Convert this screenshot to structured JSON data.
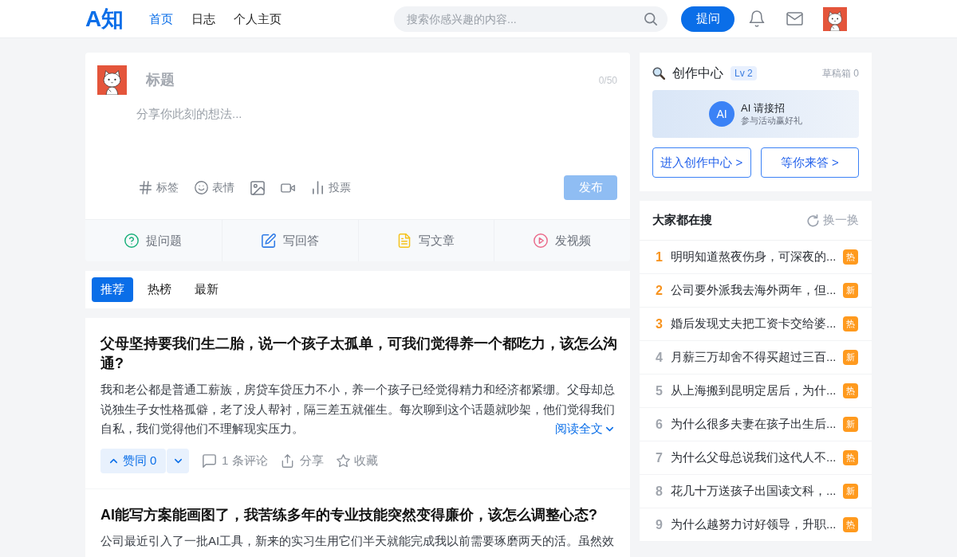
{
  "header": {
    "logo": "A知",
    "nav": [
      {
        "label": "首页",
        "selected": true
      },
      {
        "label": "日志",
        "selected": false
      },
      {
        "label": "个人主页",
        "selected": false
      }
    ],
    "search": {
      "placeholder": "搜索你感兴趣的内容..."
    },
    "ask_button": "提问"
  },
  "composer": {
    "title": {
      "placeholder": "标题"
    },
    "counter": "0/50",
    "body": {
      "placeholder": "分享你此刻的想法..."
    },
    "tools": [
      {
        "kind": "tag",
        "label": "标签"
      },
      {
        "kind": "emoji",
        "label": "表情"
      },
      {
        "kind": "image"
      },
      {
        "kind": "video"
      },
      {
        "kind": "poll",
        "label": "投票"
      }
    ],
    "publish": {
      "label": "发布",
      "disabled": true
    },
    "actions": [
      {
        "kind": "question",
        "label": "提问题"
      },
      {
        "kind": "answer",
        "label": "写回答"
      },
      {
        "kind": "article",
        "label": "写文章"
      },
      {
        "kind": "video",
        "label": "发视频"
      }
    ]
  },
  "feed_tabs": [
    {
      "label": "推荐",
      "selected": true
    },
    {
      "label": "热榜",
      "selected": false
    },
    {
      "label": "最新",
      "selected": false
    }
  ],
  "posts": [
    {
      "title": "父母坚持要我们生二胎，说一个孩子太孤单，可我们觉得养一个都吃力，该怎么沟通?",
      "body": "我和老公都是普通工薪族，房贷车贷压力不小，养一个孩子已经觉得精力和经济都紧绷。父母却总说独生子女性格孤僻，老了没人帮衬，隔三差五就催生。每次聊到这个话题就吵架，他们觉得我们自私，我们觉得他们不理解现实压力。",
      "read_more": "阅读全文",
      "vote": "赞同 0",
      "comments": "1 条评论",
      "share": "分享",
      "favorite": "收藏"
    },
    {
      "title": "AI能写方案能画图了，我苦练多年的专业技能突然变得廉价，该怎么调整心态?",
      "body": "公司最近引入了一批AI工具，新来的实习生用它们半天就能完成我以前需要琢磨两天的活。虽然效"
    }
  ],
  "creator_center": {
    "title": "创作中心",
    "level": "Lv 2",
    "drafts": "草稿箱 0",
    "banner": {
      "badge": "AI",
      "title": "AI 请接招",
      "subtitle": "参与活动赢好礼"
    },
    "buttons": [
      "进入创作中心 >",
      "等你来答 >"
    ]
  },
  "hot_search": {
    "title": "大家都在搜",
    "refresh": "换一换",
    "items": [
      {
        "rank": "1",
        "text": "明明知道熬夜伤身，可深夜的...",
        "tag": "热",
        "highlighted": true
      },
      {
        "rank": "2",
        "text": "公司要外派我去海外两年，但...",
        "tag": "新",
        "highlighted": true
      },
      {
        "rank": "3",
        "text": "婚后发现丈夫把工资卡交给婆...",
        "tag": "热",
        "highlighted": true
      },
      {
        "rank": "4",
        "text": "月薪三万却舍不得买超过三百...",
        "tag": "新",
        "highlighted": false
      },
      {
        "rank": "5",
        "text": "从上海搬到昆明定居后，为什...",
        "tag": "热",
        "highlighted": false
      },
      {
        "rank": "6",
        "text": "为什么很多夫妻在孩子出生后...",
        "tag": "新",
        "highlighted": false
      },
      {
        "rank": "7",
        "text": "为什么父母总说我们这代人不...",
        "tag": "热",
        "highlighted": false
      },
      {
        "rank": "8",
        "text": "花几十万送孩子出国读文科，...",
        "tag": "新",
        "highlighted": false
      },
      {
        "rank": "9",
        "text": "为什么越努力讨好领导，升职...",
        "tag": "热",
        "highlighted": false
      }
    ]
  }
}
